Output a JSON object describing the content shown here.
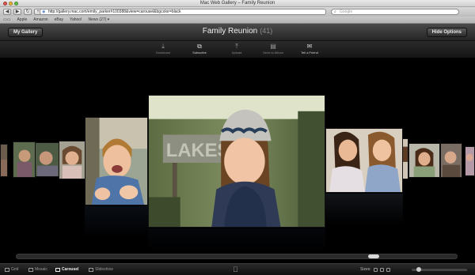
{
  "browser": {
    "window_title": "Mac Web Gallery – Family Reunion",
    "url": "http://gallery.mac.com/emily_parker#100388&view=carousel&bgcolor=black",
    "search_placeholder": "Google",
    "bookmarks": [
      "Apple",
      "Amazon",
      "eBay",
      "Yahoo!",
      "News (27) ▾"
    ]
  },
  "header": {
    "my_gallery": "My Gallery",
    "title": "Family Reunion",
    "count": "(41)",
    "hide_options": "Hide Options"
  },
  "actions": [
    {
      "label": "Download",
      "icon": "download-icon",
      "glyph": "⤓"
    },
    {
      "label": "Subscribe",
      "icon": "subscribe-icon",
      "glyph": "⧉"
    },
    {
      "label": "Upload",
      "icon": "upload-icon",
      "glyph": "⤒"
    },
    {
      "label": "Send to Album",
      "icon": "album-icon",
      "glyph": "▤"
    },
    {
      "label": "Tell a Friend",
      "icon": "envelope-icon",
      "glyph": "✉"
    }
  ],
  "views": [
    {
      "label": "Grid",
      "icon": "grid-icon"
    },
    {
      "label": "Mosaic",
      "icon": "mosaic-icon"
    },
    {
      "label": "Carousel",
      "icon": "carousel-icon",
      "selected": true
    },
    {
      "label": "Slideshow",
      "icon": "slideshow-icon"
    }
  ],
  "bottom": {
    "sizes_label": "Sizes:",
    "apple_glyph": ""
  },
  "scrubber": {
    "position": 0.82
  },
  "colors": {
    "background": "#000000",
    "header": "#3a3a3a",
    "text": "#f0f0f0"
  }
}
